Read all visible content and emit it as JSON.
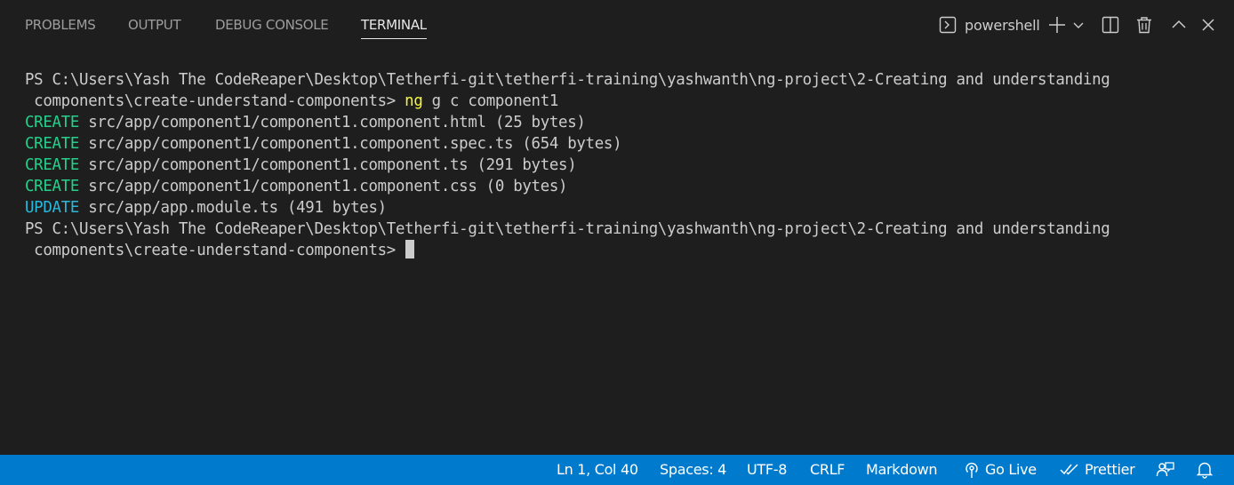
{
  "panel": {
    "tabs": [
      {
        "label": "PROBLEMS",
        "active": false
      },
      {
        "label": "OUTPUT",
        "active": false
      },
      {
        "label": "DEBUG CONSOLE",
        "active": false
      },
      {
        "label": "TERMINAL",
        "active": true
      }
    ],
    "shell_name": "powershell",
    "icons": [
      "terminal-prompt-icon",
      "plus-icon",
      "chevron-down-icon",
      "split-icon",
      "trash-icon",
      "chevron-up-icon",
      "close-icon"
    ]
  },
  "terminal": {
    "prompt1": "PS C:\\Users\\Yash The CodeReaper\\Desktop\\Tetherfi-git\\tetherfi-training\\yashwanth\\ng-project\\2-Creating and understanding",
    "prompt1_cont": " components\\create-understand-components> ",
    "command_ng": "ng",
    "command_rest": " g c component1",
    "output": [
      {
        "kind": "CREATE",
        "text": " src/app/component1/component1.component.html (25 bytes)"
      },
      {
        "kind": "CREATE",
        "text": " src/app/component1/component1.component.spec.ts (654 bytes)"
      },
      {
        "kind": "CREATE",
        "text": " src/app/component1/component1.component.ts (291 bytes)"
      },
      {
        "kind": "CREATE",
        "text": " src/app/component1/component1.component.css (0 bytes)"
      },
      {
        "kind": "UPDATE",
        "text": " src/app/app.module.ts (491 bytes)"
      }
    ],
    "prompt2": "PS C:\\Users\\Yash The CodeReaper\\Desktop\\Tetherfi-git\\tetherfi-training\\yashwanth\\ng-project\\2-Creating and understanding",
    "prompt2_cont": " components\\create-understand-components> "
  },
  "statusbar": {
    "position": "Ln 1, Col 40",
    "spaces": "Spaces: 4",
    "encoding": "UTF-8",
    "eol": "CRLF",
    "language": "Markdown",
    "go_live": "Go Live",
    "prettier": "Prettier"
  },
  "colors": {
    "background": "#1e1e1e",
    "statusbar": "#007acc",
    "create": "#23d18b",
    "update": "#29b8db",
    "command": "#f5f543"
  }
}
